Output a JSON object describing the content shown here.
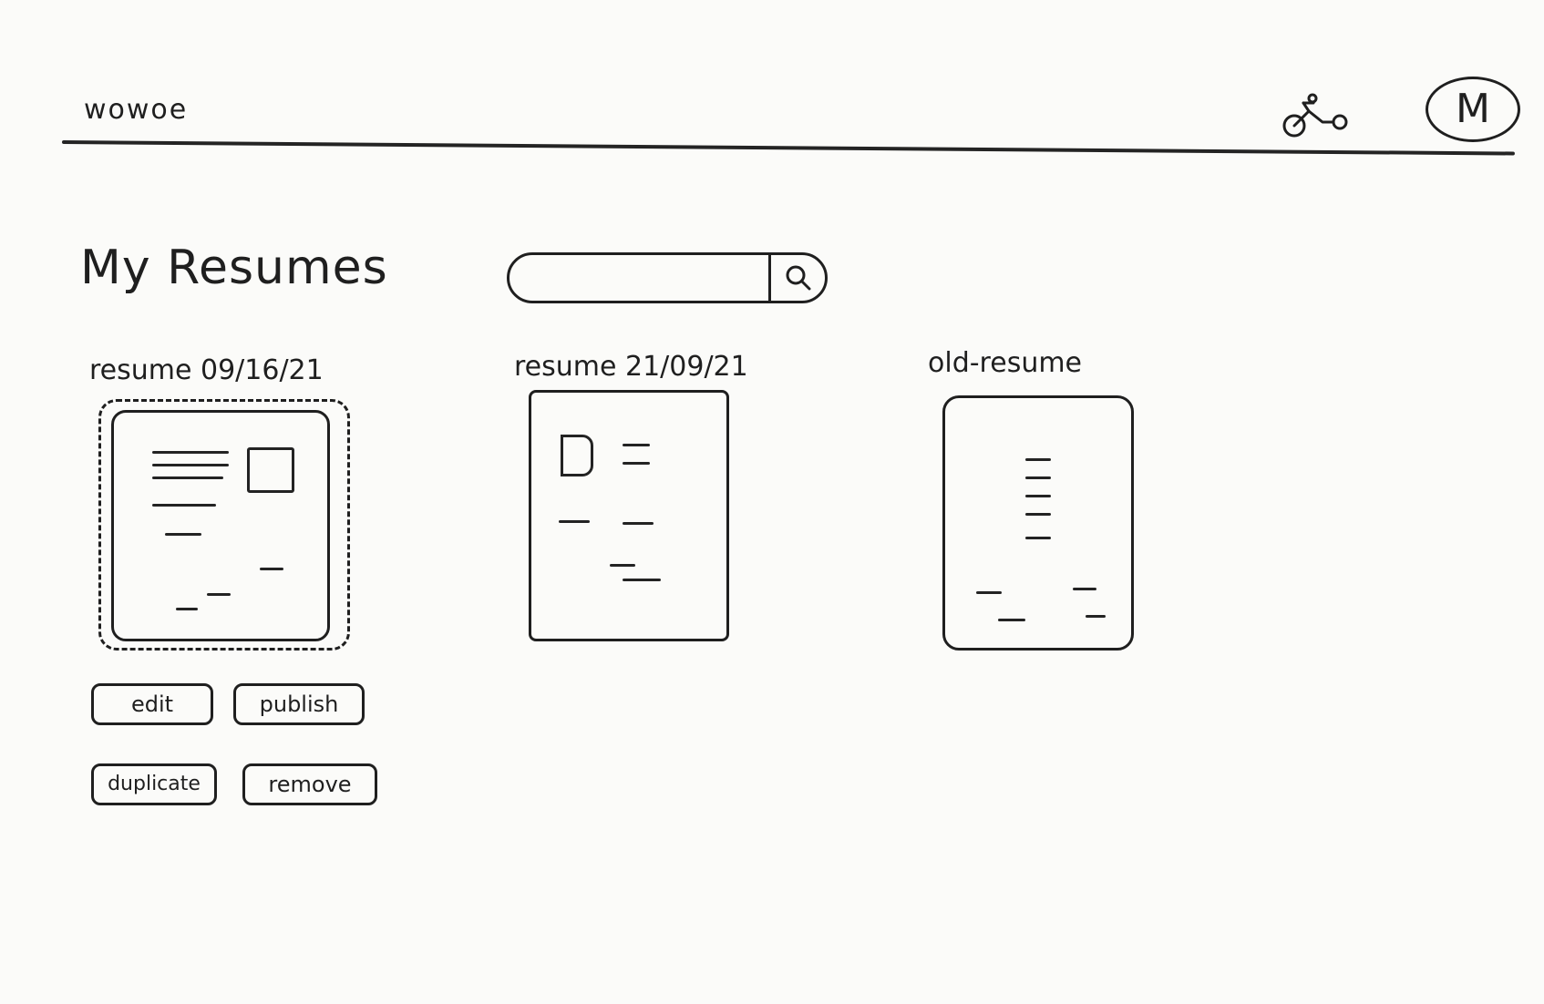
{
  "header": {
    "brand": "wowoe",
    "icon": "bike-icon",
    "avatar_letter": "M"
  },
  "page": {
    "title": "My Resumes"
  },
  "search": {
    "placeholder": "",
    "icon": "search-icon"
  },
  "resumes": [
    {
      "label": "resume 09/16/21",
      "selected": true
    },
    {
      "label": "resume 21/09/21",
      "selected": false
    },
    {
      "label": "old-resume",
      "selected": false
    }
  ],
  "actions": {
    "edit": "edit",
    "publish": "publish",
    "duplicate": "duplicate",
    "remove": "remove"
  }
}
